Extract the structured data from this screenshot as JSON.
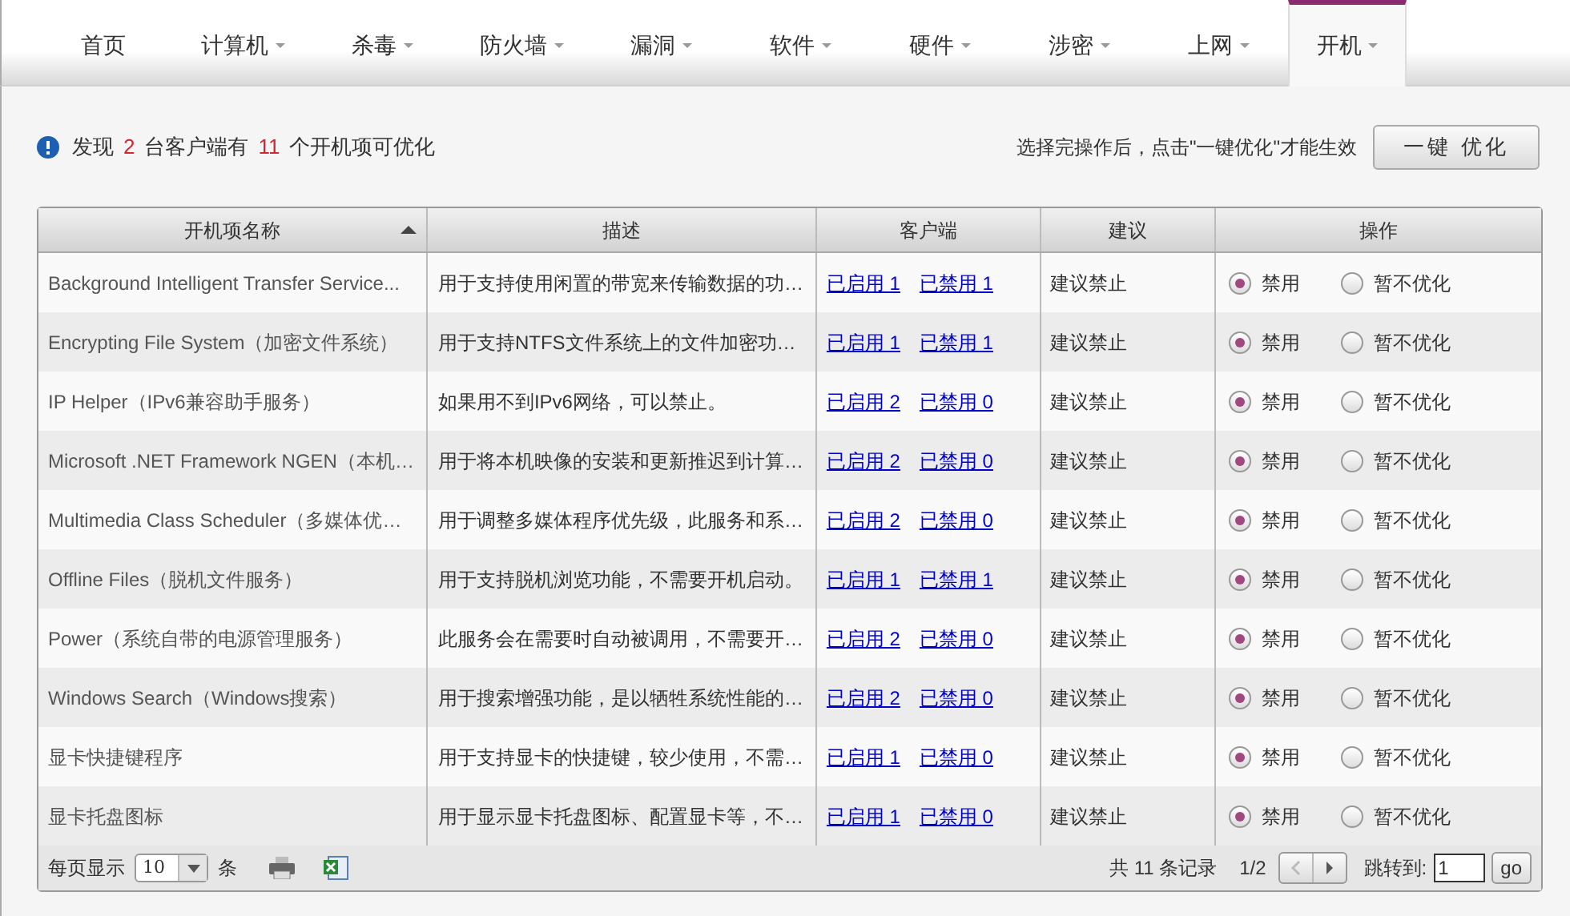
{
  "tabs": [
    {
      "label": "首页",
      "selected": false,
      "has_menu": false
    },
    {
      "label": "计算机",
      "selected": false,
      "has_menu": true
    },
    {
      "label": "杀毒",
      "selected": false,
      "has_menu": true
    },
    {
      "label": "防火墙",
      "selected": false,
      "has_menu": true
    },
    {
      "label": "漏洞",
      "selected": false,
      "has_menu": true
    },
    {
      "label": "软件",
      "selected": false,
      "has_menu": true
    },
    {
      "label": "硬件",
      "selected": false,
      "has_menu": true
    },
    {
      "label": "涉密",
      "selected": false,
      "has_menu": true
    },
    {
      "label": "上网",
      "selected": false,
      "has_menu": true
    },
    {
      "label": "开机",
      "selected": true,
      "has_menu": true
    }
  ],
  "notice": {
    "parts": [
      {
        "text": "发现",
        "highlight": false
      },
      {
        "text": "2",
        "highlight": true
      },
      {
        "text": "台客户端有",
        "highlight": false
      },
      {
        "text": "11",
        "highlight": true
      },
      {
        "text": "个开机项可优化",
        "highlight": false
      }
    ]
  },
  "hint": "选择完操作后，点击\"一键优化\"才能生效",
  "optimize_button": "一键 优化",
  "table": {
    "columns": [
      {
        "label": "开机项名称",
        "sorted": true
      },
      {
        "label": "描述",
        "sorted": false
      },
      {
        "label": "客户端",
        "sorted": false
      },
      {
        "label": "建议",
        "sorted": false
      },
      {
        "label": "操作",
        "sorted": false
      }
    ],
    "rows": [
      {
        "name": "Background Intelligent Transfer Service...",
        "description": "用于支持使用闲置的带宽来传输数据的功…",
        "enabled": "已启用 1",
        "disabled": "已禁用 1",
        "suggestion": "建议禁止",
        "options": [
          {
            "label": "禁用",
            "selected": true
          },
          {
            "label": "暂不优化",
            "selected": false
          }
        ]
      },
      {
        "name": "Encrypting File System（加密文件系统）",
        "description": "用于支持NTFS文件系统上的文件加密功…",
        "enabled": "已启用 1",
        "disabled": "已禁用 1",
        "suggestion": "建议禁止",
        "options": [
          {
            "label": "禁用",
            "selected": true
          },
          {
            "label": "暂不优化",
            "selected": false
          }
        ]
      },
      {
        "name": "IP Helper（IPv6兼容助手服务）",
        "description": "如果用不到IPv6网络，可以禁止。",
        "enabled": "已启用 2",
        "disabled": "已禁用 0",
        "suggestion": "建议禁止",
        "options": [
          {
            "label": "禁用",
            "selected": true
          },
          {
            "label": "暂不优化",
            "selected": false
          }
        ]
      },
      {
        "name": "Microsoft .NET Framework NGEN（本机…",
        "description": "用于将本机映像的安装和更新推迟到计算…",
        "enabled": "已启用 2",
        "disabled": "已禁用 0",
        "suggestion": "建议禁止",
        "options": [
          {
            "label": "禁用",
            "selected": true
          },
          {
            "label": "暂不优化",
            "selected": false
          }
        ]
      },
      {
        "name": "Multimedia Class Scheduler（多媒体优…",
        "description": "用于调整多媒体程序优先级，此服务和系…",
        "enabled": "已启用 2",
        "disabled": "已禁用 0",
        "suggestion": "建议禁止",
        "options": [
          {
            "label": "禁用",
            "selected": true
          },
          {
            "label": "暂不优化",
            "selected": false
          }
        ]
      },
      {
        "name": "Offline Files（脱机文件服务）",
        "description": "用于支持脱机浏览功能，不需要开机启动。",
        "enabled": "已启用 1",
        "disabled": "已禁用 1",
        "suggestion": "建议禁止",
        "options": [
          {
            "label": "禁用",
            "selected": true
          },
          {
            "label": "暂不优化",
            "selected": false
          }
        ]
      },
      {
        "name": "Power（系统自带的电源管理服务）",
        "description": "此服务会在需要时自动被调用，不需要开…",
        "enabled": "已启用 2",
        "disabled": "已禁用 0",
        "suggestion": "建议禁止",
        "options": [
          {
            "label": "禁用",
            "selected": true
          },
          {
            "label": "暂不优化",
            "selected": false
          }
        ]
      },
      {
        "name": "Windows Search（Windows搜索）",
        "description": "用于搜索增强功能，是以牺牲系统性能的…",
        "enabled": "已启用 2",
        "disabled": "已禁用 0",
        "suggestion": "建议禁止",
        "options": [
          {
            "label": "禁用",
            "selected": true
          },
          {
            "label": "暂不优化",
            "selected": false
          }
        ]
      },
      {
        "name": "显卡快捷键程序",
        "description": "用于支持显卡的快捷键，较少使用，不需…",
        "enabled": "已启用 1",
        "disabled": "已禁用 0",
        "suggestion": "建议禁止",
        "options": [
          {
            "label": "禁用",
            "selected": true
          },
          {
            "label": "暂不优化",
            "selected": false
          }
        ]
      },
      {
        "name": "显卡托盘图标",
        "description": "用于显示显卡托盘图标、配置显卡等，不…",
        "enabled": "已启用 1",
        "disabled": "已禁用 0",
        "suggestion": "建议禁止",
        "options": [
          {
            "label": "禁用",
            "selected": true
          },
          {
            "label": "暂不优化",
            "selected": false
          }
        ]
      }
    ]
  },
  "footer": {
    "per_page_label": "每页显示",
    "page_size": "10",
    "per_page_unit": "条",
    "total": "共 11 条记录",
    "page": "1/2",
    "jump_label": "跳转到:",
    "jump_value": "1",
    "go_button": "go"
  }
}
